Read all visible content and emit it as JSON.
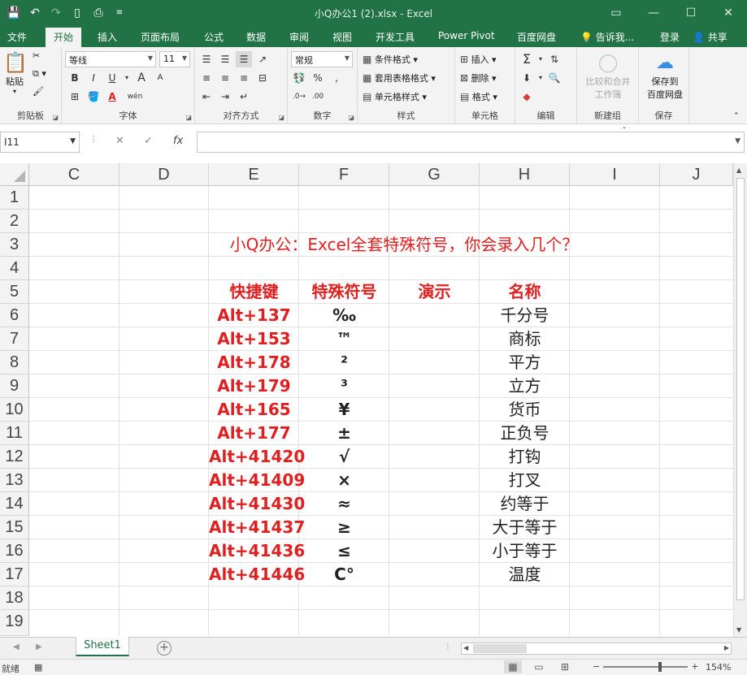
{
  "window": {
    "title": "小Q办公1 (2).xlsx - Excel",
    "minimize_icon": "minimize-icon",
    "restore_icon": "restore-icon",
    "close_icon": "close-icon"
  },
  "quick_access": {
    "save_icon": "save-icon",
    "undo_icon": "undo-icon",
    "redo_icon": "redo-icon",
    "new_icon": "new-file-icon",
    "print_preview_icon": "print-preview-icon",
    "customize_icon": "customize-icon"
  },
  "tabs": [
    {
      "label": "文件"
    },
    {
      "label": "开始"
    },
    {
      "label": "插入"
    },
    {
      "label": "页面布局"
    },
    {
      "label": "公式"
    },
    {
      "label": "数据"
    },
    {
      "label": "审阅"
    },
    {
      "label": "视图"
    },
    {
      "label": "开发工具"
    },
    {
      "label": "Power Pivot"
    },
    {
      "label": "百度网盘"
    },
    {
      "label": "告诉我..."
    }
  ],
  "account": {
    "login": "登录",
    "share": "共享"
  },
  "ribbon": {
    "clipboard": {
      "label": "剪贴板",
      "paste": "粘贴"
    },
    "font": {
      "label": "字体",
      "font_name": "等线",
      "font_size": "11",
      "bold": "B",
      "italic": "I",
      "underline": "U",
      "grow": "A",
      "shrink": "A",
      "phonetic": "wén"
    },
    "alignment": {
      "label": "对齐方式"
    },
    "number": {
      "label": "数字",
      "format": "常规",
      "percent": "%"
    },
    "styles": {
      "label": "样式",
      "conditional": "条件格式",
      "table": "套用表格格式",
      "cell": "单元格样式"
    },
    "cells": {
      "label": "单元格",
      "insert": "插入",
      "delete": "删除",
      "format": "格式"
    },
    "editing": {
      "label": "编辑"
    },
    "newgroup": {
      "label": "新建组",
      "compare": "比较和合并",
      "workbook": "工作簿"
    },
    "save": {
      "label": "保存",
      "save_to": "保存到",
      "baidu": "百度网盘"
    }
  },
  "formula_bar": {
    "name_box": "I11",
    "cancel": "✕",
    "enter": "✓",
    "fx": "fx",
    "content": ""
  },
  "columns": [
    "C",
    "D",
    "E",
    "F",
    "G",
    "H",
    "I",
    "J"
  ],
  "rows": [
    "1",
    "2",
    "3",
    "4",
    "5",
    "6",
    "7",
    "8",
    "9",
    "10",
    "11",
    "12",
    "13",
    "14",
    "15",
    "16",
    "17",
    "18",
    "19"
  ],
  "sheet": {
    "title": "小Q办公：Excel全套特殊符号，你会录入几个？",
    "headers": {
      "shortcut": "快捷键",
      "symbol": "特殊符号",
      "demo": "演示",
      "name": "名称"
    },
    "rows": [
      {
        "shortcut": "Alt+137",
        "symbol": "‰",
        "name": "千分号"
      },
      {
        "shortcut": "Alt+153",
        "symbol": "™",
        "name": "商标"
      },
      {
        "shortcut": "Alt+178",
        "symbol": "²",
        "name": "平方"
      },
      {
        "shortcut": "Alt+179",
        "symbol": "³",
        "name": "立方"
      },
      {
        "shortcut": "Alt+165",
        "symbol": "¥",
        "name": "货币"
      },
      {
        "shortcut": "Alt+177",
        "symbol": "±",
        "name": "正负号"
      },
      {
        "shortcut": "Alt+41420",
        "symbol": "√",
        "name": "打钩"
      },
      {
        "shortcut": "Alt+41409",
        "symbol": "×",
        "name": "打叉"
      },
      {
        "shortcut": "Alt+41430",
        "symbol": "≈",
        "name": "约等于"
      },
      {
        "shortcut": "Alt+41437",
        "symbol": "≥",
        "name": "大于等于"
      },
      {
        "shortcut": "Alt+41436",
        "symbol": "≤",
        "name": "小于等于"
      },
      {
        "shortcut": "Alt+41446",
        "symbol": "C°",
        "name": "温度"
      }
    ]
  },
  "sheet_tabs": [
    {
      "label": "Sheet1"
    }
  ],
  "status": {
    "ready": "就绪",
    "zoom": "154%",
    "zoom_minus": "−",
    "zoom_plus": "+"
  },
  "colors": {
    "accent": "#217346",
    "highlight_text": "#e02020"
  }
}
